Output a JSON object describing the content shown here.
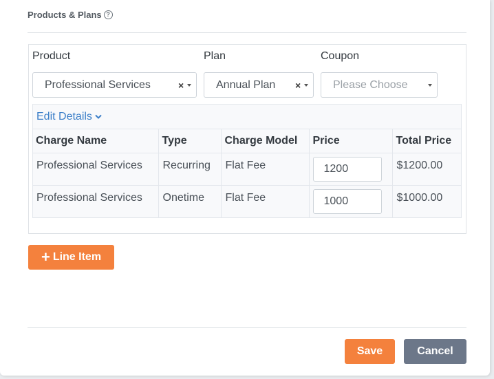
{
  "section": {
    "title": "Products & Plans",
    "help_icon": "question-circle-icon"
  },
  "fields": {
    "product": {
      "label": "Product",
      "value": "Professional Services"
    },
    "plan": {
      "label": "Plan",
      "value": "Annual Plan"
    },
    "coupon": {
      "label": "Coupon",
      "placeholder": "Please Choose"
    },
    "clear_glyph": "×"
  },
  "details": {
    "edit_link": "Edit Details",
    "columns": [
      "Charge Name",
      "Type",
      "Charge Model",
      "Price",
      "Total Price"
    ],
    "rows": [
      {
        "name": "Professional Services",
        "type": "Recurring",
        "model": "Flat Fee",
        "price": "1200",
        "total": "$1200.00"
      },
      {
        "name": "Professional Services",
        "type": "Onetime",
        "model": "Flat Fee",
        "price": "1000",
        "total": "$1000.00"
      }
    ]
  },
  "actions": {
    "add_line_item": "Line Item",
    "add_icon": "plus-icon",
    "save": "Save",
    "cancel": "Cancel"
  },
  "colors": {
    "accent": "#f4813d",
    "link": "#3a7ec8",
    "secondary": "#6c7789"
  }
}
